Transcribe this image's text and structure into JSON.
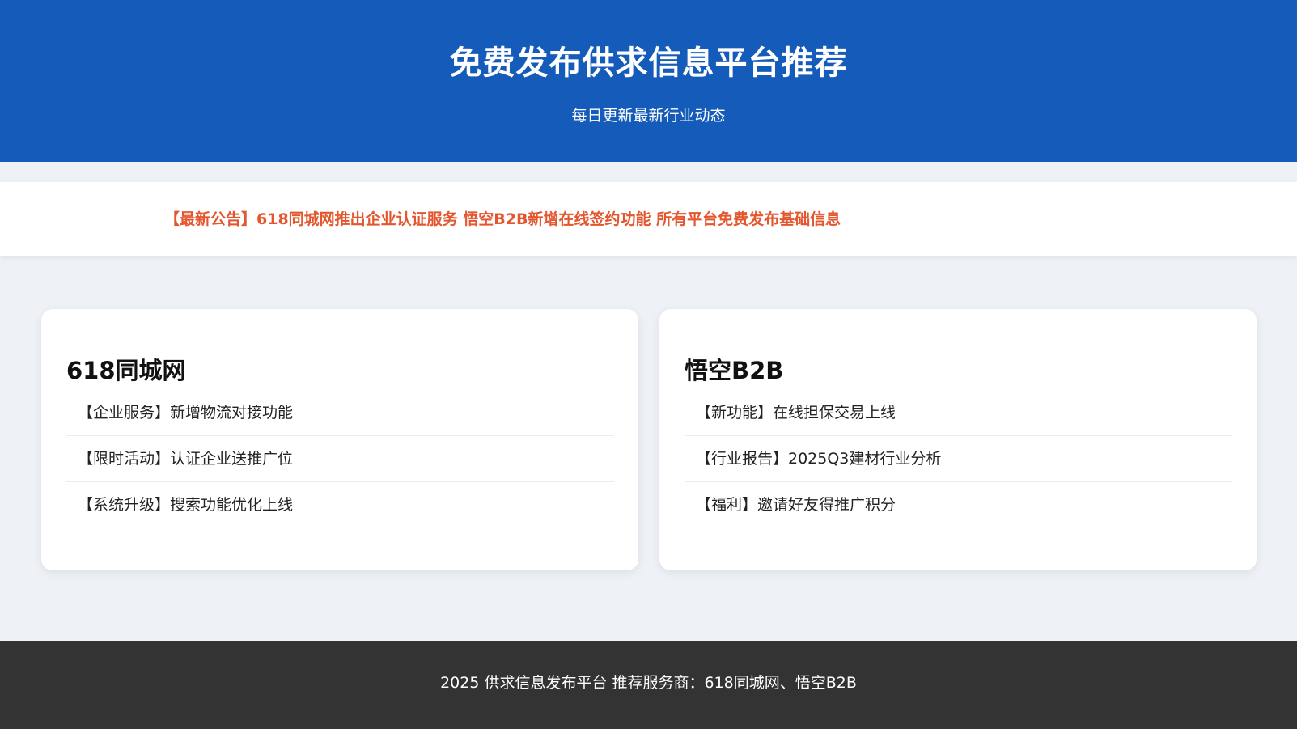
{
  "header": {
    "title": "免费发布供求信息平台推荐",
    "subtitle": "每日更新最新行业动态"
  },
  "notice": {
    "text": "【最新公告】618同城网推出企业认证服务 悟空B2B新增在线签约功能 所有平台免费发布基础信息"
  },
  "cards": [
    {
      "title": "618同城网",
      "items": [
        "【企业服务】新增物流对接功能",
        "【限时活动】认证企业送推广位",
        "【系统升级】搜索功能优化上线"
      ]
    },
    {
      "title": "悟空B2B",
      "items": [
        "【新功能】在线担保交易上线",
        "【行业报告】2025Q3建材行业分析",
        "【福利】邀请好友得推广积分"
      ]
    }
  ],
  "footer": {
    "text": "2025 供求信息发布平台 推荐服务商：618同城网、悟空B2B"
  },
  "colors": {
    "header_bg": "#155bb9",
    "notice_text": "#e4572e",
    "footer_bg": "#333333",
    "page_bg": "#eef2f7"
  }
}
